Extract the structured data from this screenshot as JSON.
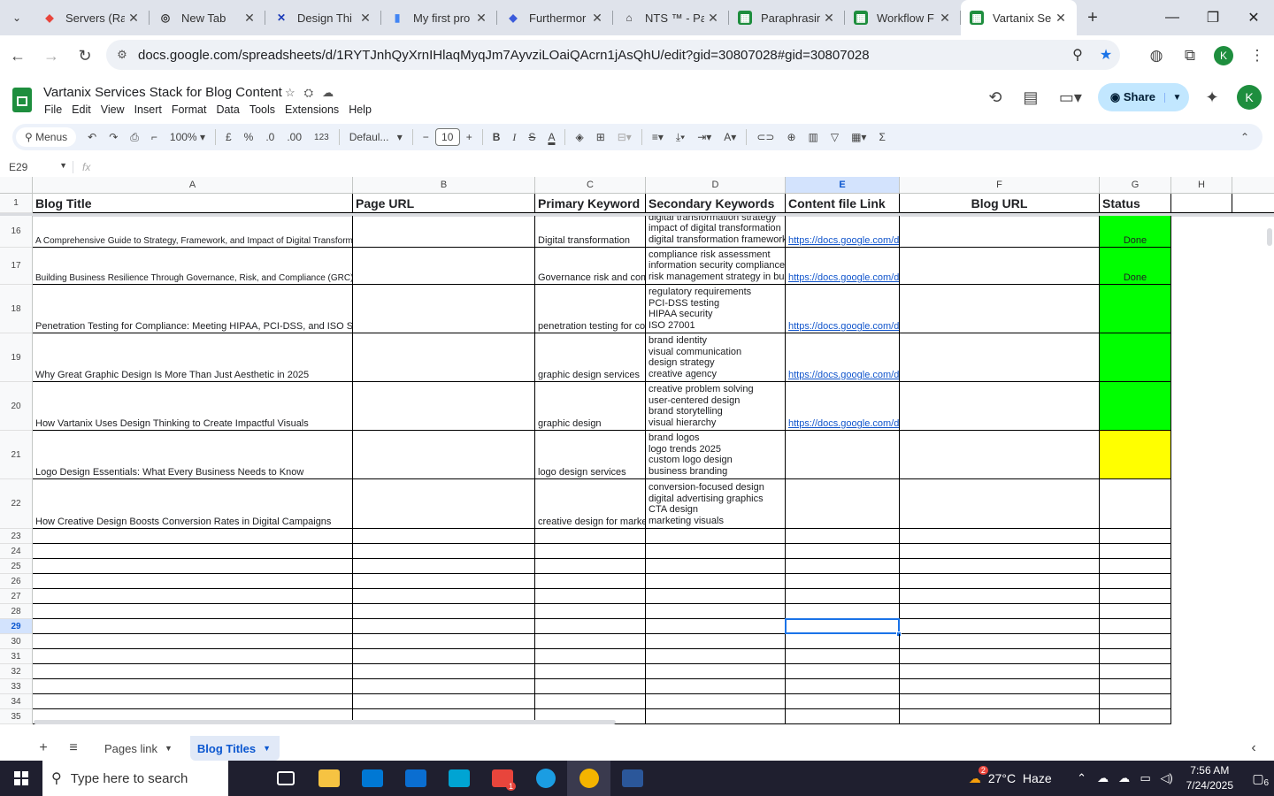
{
  "browser": {
    "tabs": [
      {
        "title": "Servers (Ra",
        "icon": "red-circle-icon",
        "color": "#e8453c",
        "active": false
      },
      {
        "title": "New Tab",
        "icon": "chrome-icon",
        "color": "#333333",
        "active": false
      },
      {
        "title": "Design Thi",
        "icon": "design-x-icon",
        "color": "#1a3ab8",
        "active": false
      },
      {
        "title": "My first pro",
        "icon": "bookmark-icon",
        "color": "#4285f4",
        "active": false
      },
      {
        "title": "Furthermor",
        "icon": "quillbot-icon",
        "color": "#3b5bdb",
        "active": false
      },
      {
        "title": "NTS ™ - Pa",
        "icon": "nts-icon",
        "color": "#333333",
        "active": false
      },
      {
        "title": "Paraphrasin",
        "icon": "sheets-icon",
        "color": "#1e8e3e",
        "active": false
      },
      {
        "title": "Workflow F",
        "icon": "sheets-icon",
        "color": "#1e8e3e",
        "active": false
      },
      {
        "title": "Vartanix Se",
        "icon": "sheets-icon",
        "color": "#1e8e3e",
        "active": true
      }
    ],
    "url": "docs.google.com/spreadsheets/d/1RYTJnhQyXrnIHlaqMyqJm7AyvziLOaiQAcrn1jAsQhU/edit?gid=30807028#gid=30807028",
    "profile_initial": "K"
  },
  "doc": {
    "title": "Vartanix Services Stack for Blog Content",
    "menus": [
      "File",
      "Edit",
      "View",
      "Insert",
      "Format",
      "Data",
      "Tools",
      "Extensions",
      "Help"
    ],
    "share_label": "Share",
    "user_initial": "K"
  },
  "toolbar": {
    "search_label": "Menus",
    "zoom": "100%",
    "currency": "£",
    "percent": "%",
    "dec_dec": ".0",
    "dec_inc": ".00",
    "number_format": "123",
    "font": "Defaul...",
    "font_size": "10"
  },
  "formula_bar": {
    "cell_ref": "E29",
    "fx": "fx",
    "value": ""
  },
  "sheet": {
    "columns": [
      "A",
      "B",
      "C",
      "D",
      "E",
      "F",
      "G",
      "H"
    ],
    "selected_column": "E",
    "header_row": {
      "row_num": "1",
      "cells": [
        "Blog Title",
        "Page URL",
        "Primary Keyword",
        "Secondary Keywords",
        "Content file Link",
        "Blog URL",
        "Status",
        ""
      ]
    },
    "rows": [
      {
        "num": "16",
        "title": "A Comprehensive Guide to Strategy, Framework, and Impact of Digital Transformation",
        "page_url": "",
        "primary": "Digital transformation",
        "secondary": [
          "digital transformation strategy",
          "impact of digital transformation",
          "digital transformation framework"
        ],
        "content_link": "https://docs.google.com/do",
        "blog_url": "",
        "status": "Done",
        "status_color": "#00ff00"
      },
      {
        "num": "17",
        "title": "Building Business Resilience Through Governance, Risk, and Compliance (GRC)",
        "page_url": "",
        "primary": "Governance risk and com",
        "secondary": [
          "compliance risk assessment",
          "information security compliance",
          "risk management strategy in bus"
        ],
        "content_link": "https://docs.google.com/do",
        "blog_url": "",
        "status": "Done",
        "status_color": "#00ff00"
      },
      {
        "num": "18",
        "title": "Penetration Testing for Compliance: Meeting HIPAA, PCI-DSS, and ISO Stan",
        "page_url": "",
        "primary": "penetration testing for cor",
        "secondary": [
          "regulatory requirements",
          "PCI-DSS testing",
          "HIPAA security",
          "ISO 27001"
        ],
        "content_link": "https://docs.google.com/do",
        "blog_url": "",
        "status": "",
        "status_color": "#00ff00"
      },
      {
        "num": "19",
        "title": "Why Great Graphic Design Is More Than Just Aesthetic in 2025",
        "page_url": "",
        "primary": "graphic design services",
        "secondary": [
          "brand identity",
          "visual communication",
          "design strategy",
          "creative agency"
        ],
        "content_link": "https://docs.google.com/do",
        "blog_url": "",
        "status": "",
        "status_color": "#00ff00"
      },
      {
        "num": "20",
        "title": "How Vartanix Uses Design Thinking to Create Impactful Visuals",
        "page_url": "",
        "primary": "graphic design",
        "secondary": [
          "creative problem solving",
          "user-centered design",
          "brand storytelling",
          "visual hierarchy"
        ],
        "content_link": "https://docs.google.com/do",
        "blog_url": "",
        "status": "",
        "status_color": "#00ff00"
      },
      {
        "num": "21",
        "title": "Logo Design Essentials: What Every Business Needs to Know",
        "page_url": "",
        "primary": "logo design services",
        "secondary": [
          "brand logos",
          "logo trends 2025",
          "custom logo design",
          "business branding"
        ],
        "content_link": "",
        "blog_url": "",
        "status": "",
        "status_color": "#ffff00"
      },
      {
        "num": "22",
        "title": "How Creative Design Boosts Conversion Rates in Digital Campaigns",
        "page_url": "",
        "primary": "creative design for marke",
        "secondary": [
          "conversion-focused design",
          "digital advertising graphics",
          "CTA design",
          "marketing visuals"
        ],
        "content_link": "",
        "blog_url": "",
        "status": "",
        "status_color": "#ffffff"
      }
    ],
    "empty_rows": [
      "23",
      "24",
      "25",
      "26",
      "27",
      "28",
      "29",
      "30",
      "31",
      "32",
      "33",
      "34",
      "35"
    ],
    "selected_row": "29"
  },
  "sheet_tabs": [
    {
      "label": "Pages link",
      "active": false
    },
    {
      "label": "Blog Titles",
      "active": true
    }
  ],
  "taskbar": {
    "search_placeholder": "Type here to search",
    "weather": "27°C  Haze",
    "weather_badge": "2",
    "time": "7:56 AM",
    "date": "7/24/2025",
    "notifications": "6",
    "apps": [
      {
        "name": "task-view",
        "color": "#ffffff"
      },
      {
        "name": "file-explorer",
        "color": "#f6c342"
      },
      {
        "name": "microsoft-store",
        "color": "#0078d4"
      },
      {
        "name": "mail",
        "color": "#0a6ed1"
      },
      {
        "name": "app-blue-diamond",
        "color": "#00a4d3"
      },
      {
        "name": "zoom",
        "color": "#e8453c",
        "badge": "1"
      },
      {
        "name": "edge",
        "color": "#1b9de2"
      },
      {
        "name": "chrome",
        "color": "#f4b400"
      },
      {
        "name": "word",
        "color": "#2b579a"
      }
    ]
  }
}
